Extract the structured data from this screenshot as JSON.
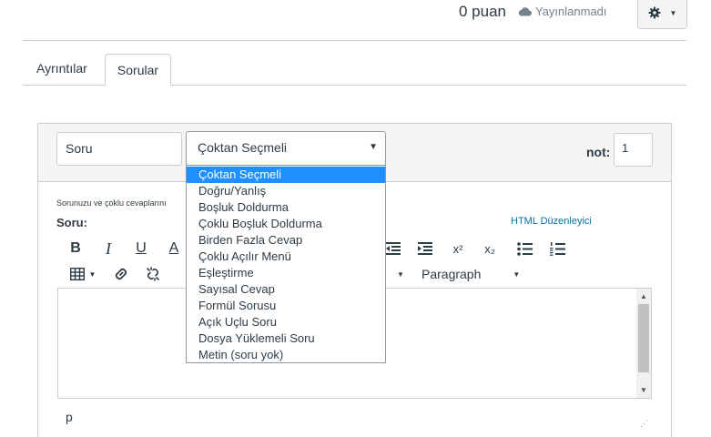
{
  "header": {
    "points_label": "0 puan",
    "publish_status": "Yayınlanmadı",
    "settings_caret": "▼"
  },
  "tabs": [
    {
      "label": "Ayrıntılar",
      "active": false
    },
    {
      "label": "Sorular",
      "active": true
    }
  ],
  "question": {
    "name_value": "Soru",
    "type_selected": "Çoktan Seçmeli",
    "points_label": "not:",
    "points_value": "1",
    "hint_text": "Sorunuzu ve çoklu cevaplarını",
    "editor_label": "Soru:",
    "html_editor_link": "HTML Düzenleyici"
  },
  "toolbar": {
    "bold": "B",
    "italic": "I",
    "underline": "U",
    "text_color": "A",
    "superscript": "x²",
    "subscript": "x₂",
    "paragraph_format": "Paragraph"
  },
  "editor": {
    "status_path": "p"
  },
  "dropdown": {
    "options": [
      "Çoktan Seçmeli",
      "Doğru/Yanlış",
      "Boşluk Doldurma",
      "Çoklu Boşluk Doldurma",
      "Birden Fazla Cevap",
      "Çoklu Açılır Menü",
      "Eşleştirme",
      "Sayısal Cevap",
      "Formül Sorusu",
      "Açık Uçlu Soru",
      "Dosya Yüklemeli Soru",
      "Metin (soru yok)"
    ],
    "selected_index": 0
  },
  "colors": {
    "accent": "#1e90ff",
    "link": "#0770a3",
    "text": "#2d3b45",
    "border": "#c7cdd1"
  }
}
